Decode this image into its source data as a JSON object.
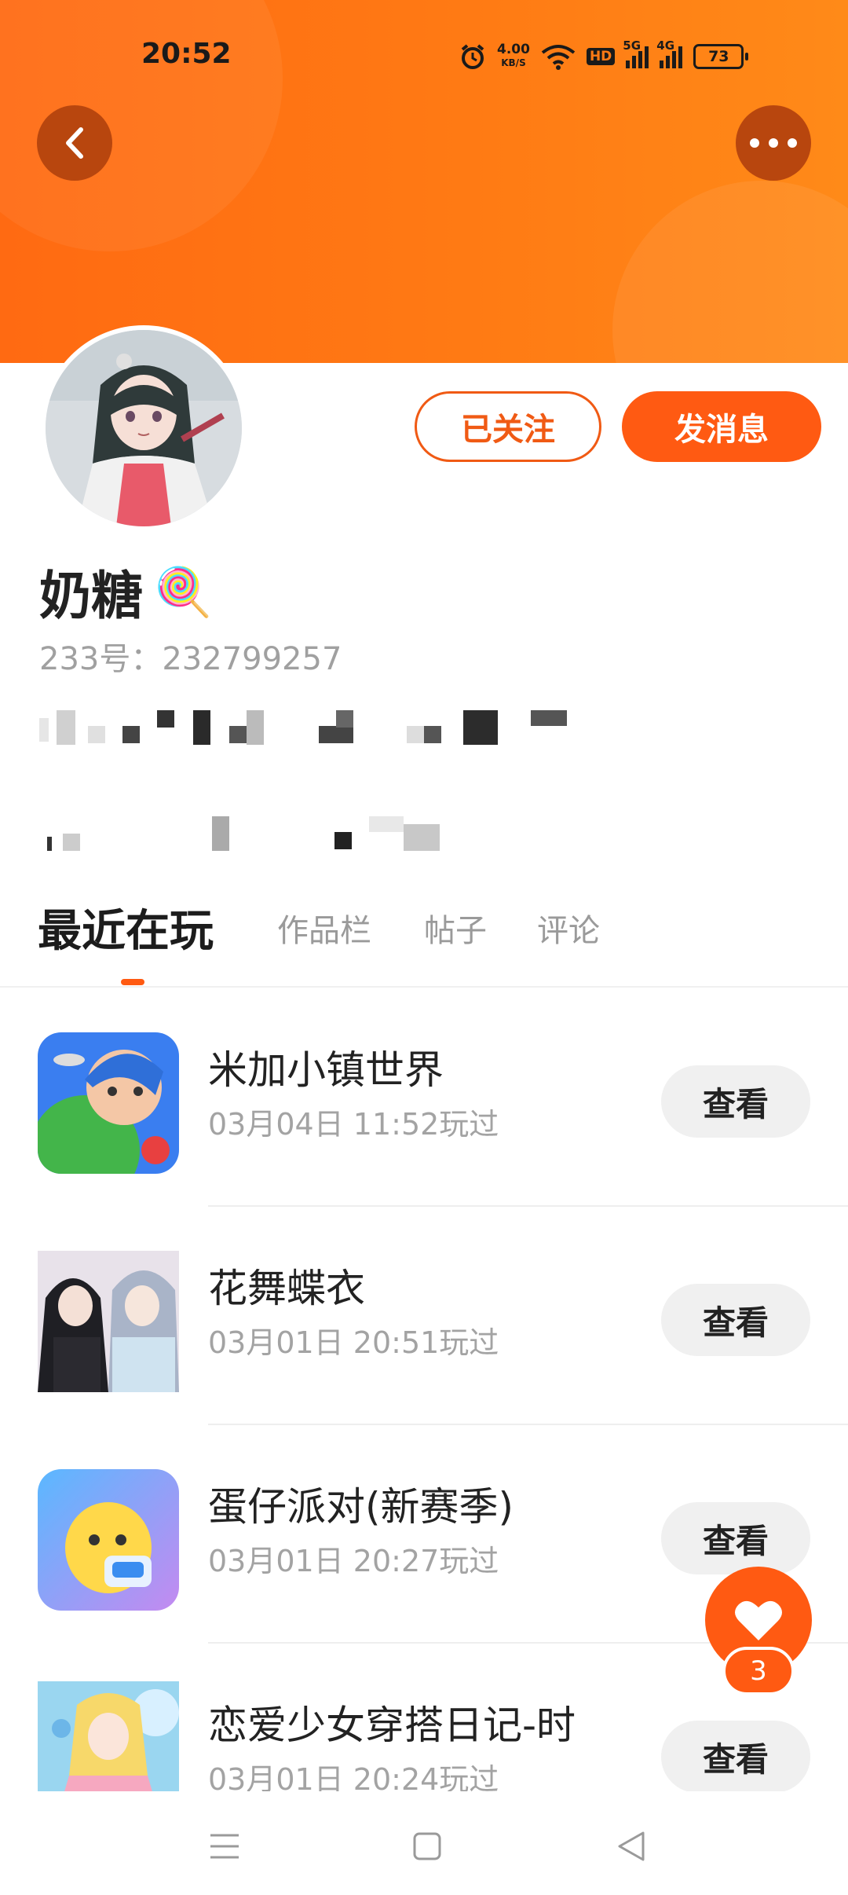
{
  "status_bar": {
    "time": "20:52",
    "net_speed_value": "4.00",
    "net_speed_unit": "KB/S",
    "hd_label": "HD",
    "signal1_label": "5G",
    "signal2_label": "4G",
    "battery": "73"
  },
  "profile": {
    "username": "奶糖",
    "username_emoji": "🍭",
    "uid_text": "233号：232799257",
    "follow_label": "已关注",
    "message_label": "发消息"
  },
  "tabs": [
    {
      "label": "最近在玩"
    },
    {
      "label": "作品栏"
    },
    {
      "label": "帖子"
    },
    {
      "label": "评论"
    }
  ],
  "games": [
    {
      "name": "米加小镇世界",
      "time": "03月04日 11:52玩过",
      "button": "查看"
    },
    {
      "name": "花舞蝶衣",
      "time": "03月01日 20:51玩过",
      "button": "查看"
    },
    {
      "name": "蛋仔派对(新赛季)",
      "time": "03月01日 20:27玩过",
      "button": "查看"
    },
    {
      "name": "恋爱少女穿搭日记-时",
      "time": "03月01日 20:24玩过",
      "button": "查看"
    }
  ],
  "fab": {
    "count": "3"
  },
  "colors": {
    "accent": "#ff5a12",
    "header": "#ff7a14"
  }
}
